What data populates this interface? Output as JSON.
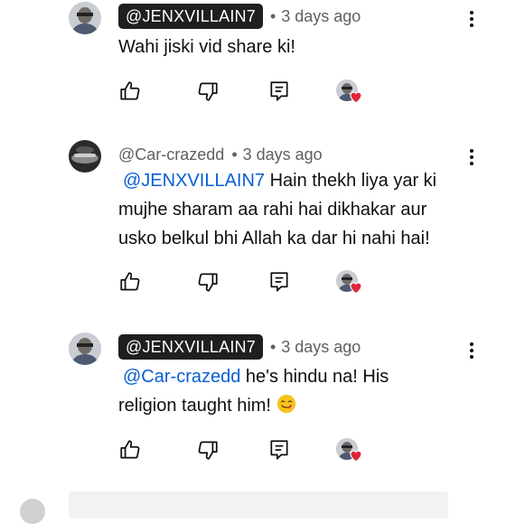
{
  "comments": [
    {
      "handle": "@JENXVILLAIN7",
      "handle_style": "badge",
      "time": "3 days ago",
      "mention": "",
      "text": "Wahi jiski vid share ki!",
      "emoji": ""
    },
    {
      "handle": "@Car-crazedd",
      "handle_style": "plain",
      "time": "3 days ago",
      "mention": "@JENXVILLAIN7",
      "text": " Hain thekh liya yar ki mujhe sharam aa rahi hai dikhakar aur usko belkul bhi Allah ka dar hi nahi hai!",
      "emoji": ""
    },
    {
      "handle": "@JENXVILLAIN7",
      "handle_style": "badge",
      "time": "3 days ago",
      "mention": "@Car-crazedd",
      "text": "  he's hindu na! His religion taught him! ",
      "emoji": "face-savoring-food"
    }
  ],
  "separator": "•",
  "icons": {
    "like": "thumbs-up-icon",
    "dislike": "thumbs-down-icon",
    "reply": "reply-icon",
    "more": "more-vertical-icon",
    "heart": "creator-heart-icon"
  },
  "colors": {
    "mention": "#065fd4",
    "badge_bg": "#1f1f1f",
    "heart": "#e0263a",
    "meta_text": "#606060"
  }
}
